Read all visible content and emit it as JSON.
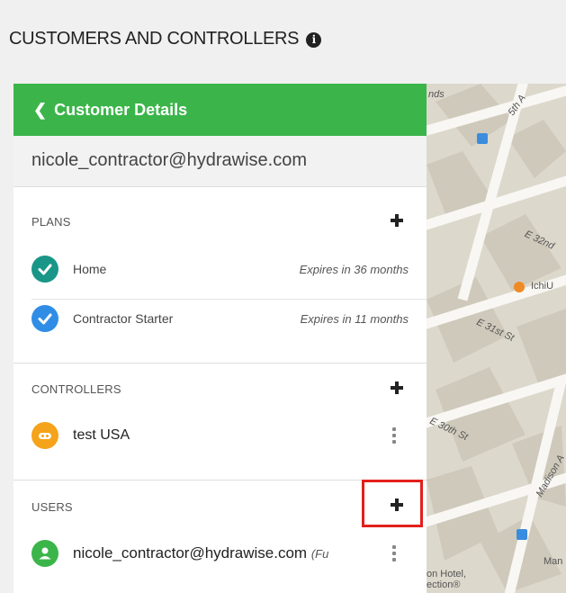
{
  "header": {
    "title": "CUSTOMERS AND CONTROLLERS",
    "info_icon": "i"
  },
  "panel": {
    "back_label": "Customer Details",
    "back_icon": "chevron-left",
    "customer_email": "nicole_contractor@hydrawise.com"
  },
  "plans": {
    "title": "PLANS",
    "items": [
      {
        "label": "Home",
        "meta": "Expires in 36 months",
        "color": "#1a9688"
      },
      {
        "label": "Contractor Starter",
        "meta": "Expires in 11 months",
        "color": "#2f8de6"
      }
    ]
  },
  "controllers": {
    "title": "CONTROLLERS",
    "items": [
      {
        "label": "test USA",
        "color": "#f5a31a"
      }
    ]
  },
  "users": {
    "title": "USERS",
    "items": [
      {
        "label": "nicole_contractor@hydrawise.com",
        "meta": "(Fu",
        "color": "#3bb54a"
      }
    ]
  },
  "map": {
    "labels": [
      "nds",
      "5th A",
      "E 32nd",
      "IchiU",
      "E 31st St",
      "E 30th St",
      "Madison A",
      "Man",
      "on Hotel,",
      "ection®"
    ]
  },
  "colors": {
    "accent_green": "#3bb54a",
    "highlight_red": "#e3201b"
  }
}
